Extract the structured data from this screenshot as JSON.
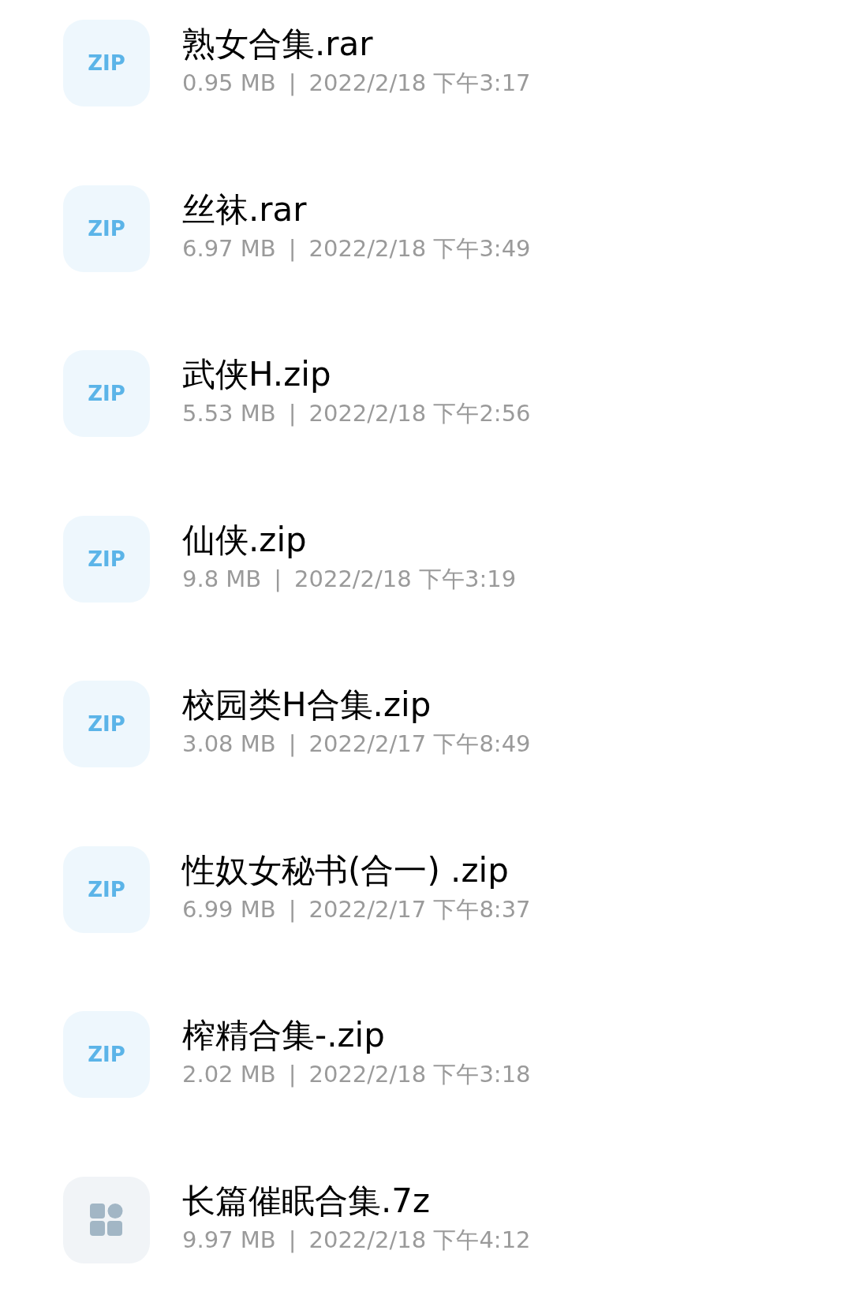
{
  "files": [
    {
      "kind": "zip",
      "badge": "ZIP",
      "name": "熟女合集.rar",
      "size": "0.95 MB",
      "separator": "|",
      "date": "2022/2/18 下午3:17"
    },
    {
      "kind": "zip",
      "badge": "ZIP",
      "name": "丝袜.rar",
      "size": "6.97 MB",
      "separator": "|",
      "date": "2022/2/18 下午3:49"
    },
    {
      "kind": "zip",
      "badge": "ZIP",
      "name": "武侠H.zip",
      "size": "5.53 MB",
      "separator": "|",
      "date": "2022/2/18 下午2:56"
    },
    {
      "kind": "zip",
      "badge": "ZIP",
      "name": "仙侠.zip",
      "size": "9.8 MB",
      "separator": "|",
      "date": "2022/2/18 下午3:19"
    },
    {
      "kind": "zip",
      "badge": "ZIP",
      "name": "校园类H合集.zip",
      "size": "3.08 MB",
      "separator": "|",
      "date": "2022/2/17 下午8:49"
    },
    {
      "kind": "zip",
      "badge": "ZIP",
      "name": "性奴女秘书(合一) .zip",
      "size": "6.99 MB",
      "separator": "|",
      "date": "2022/2/17 下午8:37"
    },
    {
      "kind": "zip",
      "badge": "ZIP",
      "name": "榨精合集-.zip",
      "size": "2.02 MB",
      "separator": "|",
      "date": "2022/2/18 下午3:18"
    },
    {
      "kind": "other",
      "name": "长篇催眠合集.7z",
      "size": "9.97 MB",
      "separator": "|",
      "date": "2022/2/18 下午4:12"
    }
  ]
}
